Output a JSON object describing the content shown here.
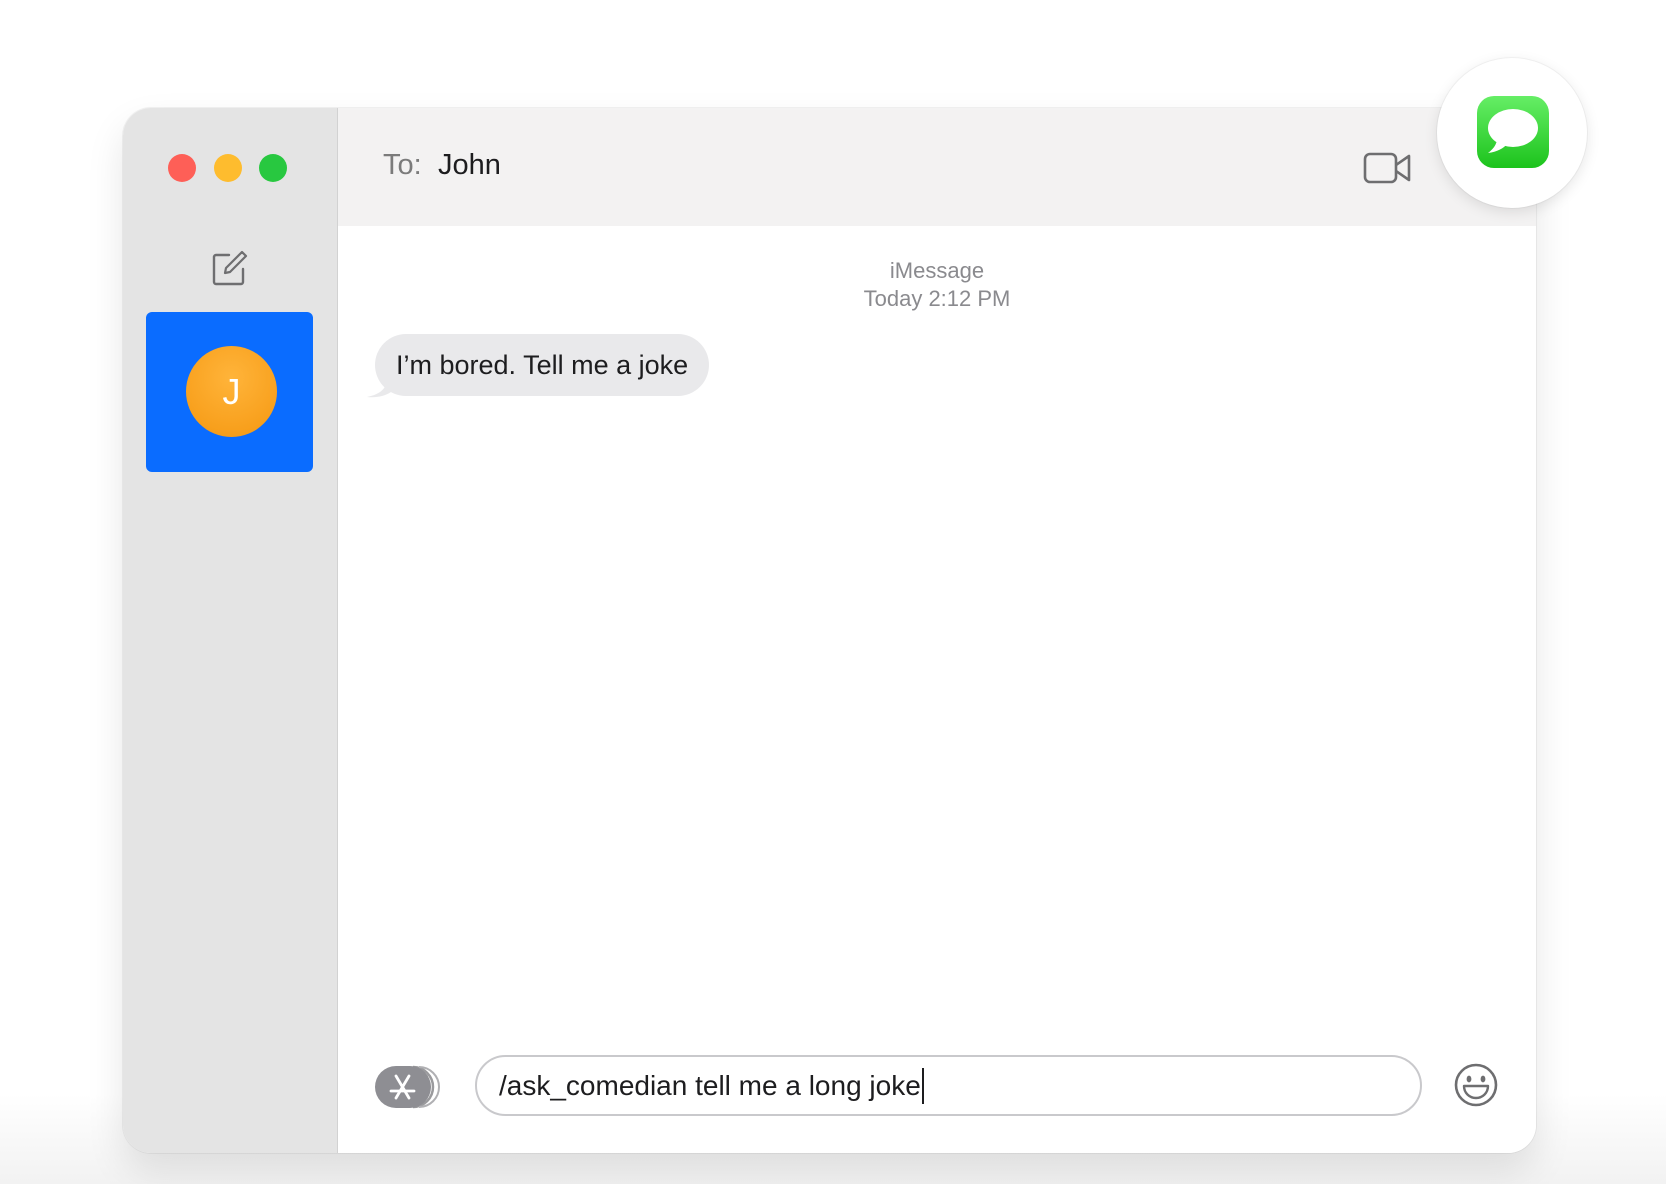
{
  "window": {
    "controls": {
      "close": "close-button",
      "minimize": "minimize-button",
      "zoom": "zoom-button"
    }
  },
  "sidebar": {
    "compose_icon": "compose-icon",
    "conversations": [
      {
        "initial": "J",
        "selected": true
      }
    ]
  },
  "header": {
    "to_label": "To:",
    "recipient": "John",
    "video_icon": "video-camera-icon"
  },
  "conversation": {
    "service": "iMessage",
    "timestamp": "Today 2:12 PM",
    "messages": [
      {
        "direction": "incoming",
        "text": "I’m bored. Tell me a joke"
      }
    ]
  },
  "composer": {
    "apps_icon": "app-store-icon",
    "input_value": "/ask_comedian tell me a long joke",
    "emoji_icon": "emoji-icon"
  },
  "app_badge": {
    "icon": "messages-app-icon"
  },
  "colors": {
    "selected_conversation": "#0a6cff",
    "avatar": "#f8a01d",
    "incoming_bubble": "#e9e9eb",
    "messages_green": "#28c840"
  }
}
